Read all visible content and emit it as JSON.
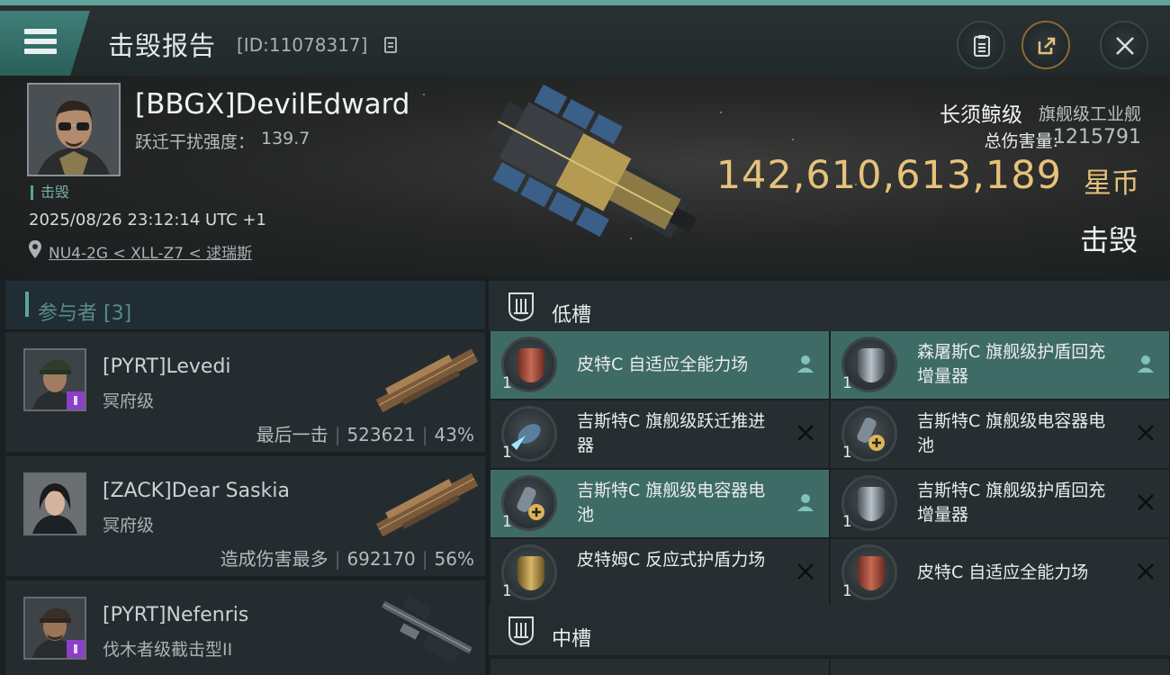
{
  "header": {
    "title": "击毁报告",
    "id_text": "[ID:11078317]",
    "buttons": {
      "report": "clipboard-icon",
      "share": "share-icon",
      "close": "close-icon"
    }
  },
  "victim": {
    "name": "[BBGX]DevilEdward",
    "warp_label": "跃迁干扰强度：",
    "warp_value": "139.7",
    "status_tag": "击毁",
    "time": "2025/08/26 23:12:14 UTC +1",
    "location": "NU4-2G < XLL-Z7 < 逑瑞斯"
  },
  "ship": {
    "name": "长须鲸级",
    "class": "旗舰级工业舰",
    "damage_label": "总伤害量:",
    "damage_value": "1215791",
    "isk_value": "142,610,613,189",
    "isk_unit": "星币",
    "result": "击毁"
  },
  "participants": {
    "title": "参与者 [3]",
    "items": [
      {
        "name": "[PYRT]Levedi",
        "ship": "冥府级",
        "stat_label": "最后一击",
        "damage": "523621",
        "percent": "43%",
        "badge": true
      },
      {
        "name": "[ZACK]Dear Saskia",
        "ship": "冥府级",
        "stat_label": "造成伤害最多",
        "damage": "692170",
        "percent": "56%",
        "badge": false
      },
      {
        "name": "[PYRT]Nefenris",
        "ship": "伐木者级截击型II",
        "badge": true
      }
    ]
  },
  "fitting": {
    "low_label": "低槽",
    "mid_label": "中槽",
    "modules": [
      {
        "name": "皮特C 自适应全能力场",
        "qty": "1",
        "status": "person-icon",
        "highlight": true
      },
      {
        "name": "森屠斯C 旗舰级护盾回充增量器",
        "qty": "1",
        "status": "person-icon",
        "highlight": true
      },
      {
        "name": "吉斯特C 旗舰级跃迁推进器",
        "qty": "1",
        "status": "cross-icon",
        "highlight": false
      },
      {
        "name": "吉斯特C 旗舰级电容器电池",
        "qty": "1",
        "status": "cross-icon",
        "highlight": false
      },
      {
        "name": "吉斯特C 旗舰级电容器电池",
        "qty": "1",
        "status": "person-icon",
        "highlight": true
      },
      {
        "name": "吉斯特C 旗舰级护盾回充增量器",
        "qty": "1",
        "status": "cross-icon",
        "highlight": false
      },
      {
        "name": "皮特姆C 反应式护盾力场",
        "qty": "1",
        "status": "cross-icon",
        "highlight": false
      },
      {
        "name": "皮特C 自适应全能力场",
        "qty": "1",
        "status": "cross-icon",
        "highlight": false
      }
    ]
  },
  "colors": {
    "accent": "#5fa39a",
    "isk": "#e7c27a",
    "highlight": "#3f6b66"
  }
}
